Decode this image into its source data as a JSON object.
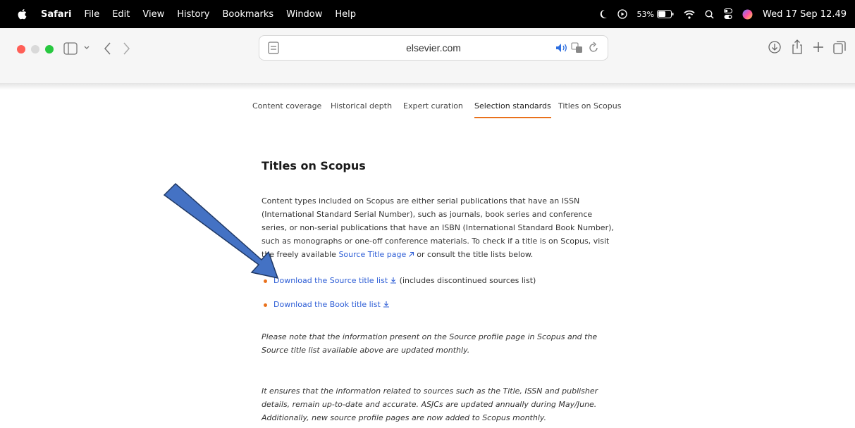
{
  "menubar": {
    "app_name": "Safari",
    "items": [
      "File",
      "Edit",
      "View",
      "History",
      "Bookmarks",
      "Window",
      "Help"
    ],
    "battery_percent": "53%",
    "datetime": "Wed 17 Sep 12.49"
  },
  "toolbar": {
    "url": "elsevier.com"
  },
  "page": {
    "tabs": [
      "Content coverage",
      "Historical depth",
      "Expert curation",
      "Selection standards",
      "Titles on Scopus"
    ],
    "active_tab": "Selection standards",
    "heading": "Titles on Scopus",
    "intro_text": "Content types included on Scopus are either serial publications that have an ISSN (International Standard Serial Number), such as journals, book series and conference series, or non-serial publications that have an ISBN (International Standard Book Number), such as monographs or one-off conference materials. To check if a title is on Scopus, visit the freely available",
    "source_title_link": "Source Title page",
    "intro_end": "or consult the title lists below.",
    "downloads": [
      {
        "link": "Download the Source title list",
        "note": "(includes discontinued sources list)"
      },
      {
        "link": "Download the Book title list",
        "note": ""
      }
    ],
    "note1": "Please note that the information present on the Source profile page in Scopus and the Source title list available above are updated monthly.",
    "note2": "It ensures that the information related to sources such as the Title, ISSN and publisher details, remain up-to-date and accurate. ASJCs are updated annually during May/June. Additionally, new source profile pages are now added to Scopus monthly."
  },
  "colors": {
    "accent": "#e9711c",
    "link": "#2e5ed6",
    "arrow_fill": "#4472c4",
    "arrow_stroke": "#1f3864"
  }
}
